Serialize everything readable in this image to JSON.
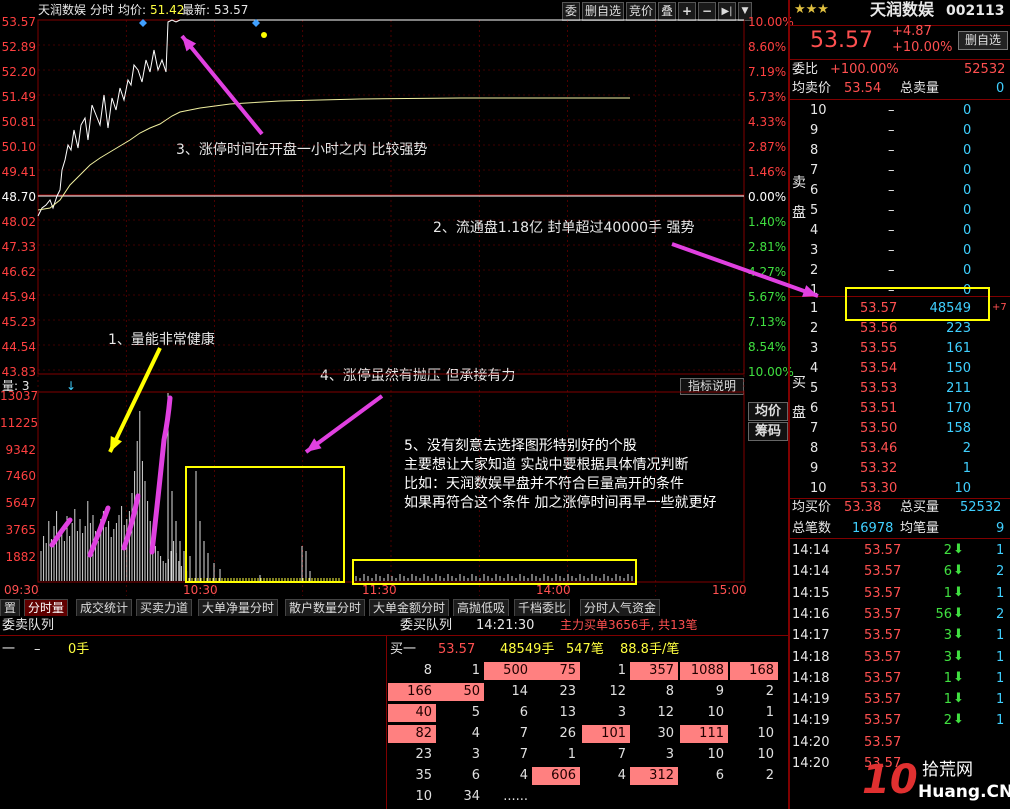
{
  "colors": {
    "up": "#ff5050",
    "down": "#40e040",
    "price_line": "#ffffff",
    "avg_line": "#f0f0a0",
    "grid": "#800000",
    "annot": "#ffffff",
    "arrow": "#e040e0",
    "box": "#ffff00"
  },
  "header": {
    "stock": "天润数娱",
    "mode": "分时",
    "avg_label": "均价:",
    "avg_value": "51.42",
    "latest_label": "最新:",
    "latest_value": "53.57",
    "buttons": [
      "委",
      "删自选",
      "竞价",
      "叠"
    ],
    "icons": [
      "plus-icon",
      "minus-icon",
      "step-right-icon",
      "dropdown-icon"
    ]
  },
  "price_axis": {
    "left": [
      "53.57",
      "52.89",
      "52.20",
      "51.49",
      "50.81",
      "50.10",
      "49.41",
      "48.70",
      "48.02",
      "47.33",
      "46.62",
      "45.94",
      "45.23",
      "44.54",
      "43.83"
    ],
    "right": [
      "10.00%",
      "8.60%",
      "7.19%",
      "5.73%",
      "4.33%",
      "2.87%",
      "1.46%",
      "0.00%",
      "1.40%",
      "2.81%",
      "4.27%",
      "5.67%",
      "7.13%",
      "8.54%",
      "10.00%"
    ]
  },
  "volume": {
    "label": "量: 3",
    "indicator_btn": "指标说明",
    "side_btns": [
      "均价",
      "筹码"
    ],
    "axis": [
      "13037",
      "11225",
      "9342",
      "7460",
      "5647",
      "3765",
      "1882"
    ],
    "times": [
      "09:30",
      "10:30",
      "11:30",
      "14:00",
      "15:00"
    ]
  },
  "chart_data": {
    "type": "line",
    "x": [
      "09:30",
      "10:00",
      "10:30",
      "11:00",
      "11:30",
      "13:30",
      "14:00",
      "14:30",
      "15:00"
    ],
    "series": [],
    "ylim": [
      43.83,
      53.57
    ]
  },
  "annotations": {
    "a1": "1、量能非常健康",
    "a2": "2、流通盘1.18亿 封单超过40000手 强势",
    "a3": "3、涨停时间在开盘一小时之内 比较强势",
    "a4": "4、涨停虽然有抛压 但承接有力",
    "a5": [
      "5、没有刻意去选择图形特别好的个股",
      "主要想让大家知道 实战中要根据具体情况判断",
      "比如：天润数娱早盘并不符合巨量高开的条件",
      "如果再符合这个条件 加之涨停时间再早一些就更好"
    ]
  },
  "tabs": [
    "置",
    "分时量",
    "成交统计",
    "买卖力道",
    "大单净量分时",
    "散户数量分时",
    "大单金额分时",
    "高抛低吸",
    "千档委比",
    "分时人气资金"
  ],
  "queue": {
    "sell_title": "委卖队列",
    "buy_title": "委买队列",
    "time": "14:21:30",
    "main_buy": "主力买单3656手, 共13笔",
    "sell_row": {
      "label": "一",
      "dash": "–",
      "qty": "0手"
    },
    "buy_head": {
      "label": "买一",
      "price": "53.57",
      "qty": "48549手",
      "count": "547笔",
      "avg": "88.8手/笔"
    },
    "grid": [
      [
        [
          "8",
          0
        ],
        [
          "1",
          0
        ],
        [
          "500",
          1
        ],
        [
          "75",
          1
        ],
        [
          "1",
          0
        ],
        [
          "357",
          1
        ],
        [
          "1088",
          1
        ],
        [
          "168",
          1
        ]
      ],
      [
        [
          "166",
          1
        ],
        [
          "50",
          1
        ],
        [
          "14",
          0
        ],
        [
          "23",
          0
        ],
        [
          "12",
          0
        ],
        [
          "8",
          0
        ],
        [
          "9",
          0
        ],
        [
          "2",
          0
        ]
      ],
      [
        [
          "40",
          1
        ],
        [
          "5",
          0
        ],
        [
          "6",
          0
        ],
        [
          "13",
          0
        ],
        [
          "3",
          0
        ],
        [
          "12",
          0
        ],
        [
          "10",
          0
        ],
        [
          "1",
          0
        ]
      ],
      [
        [
          "82",
          1
        ],
        [
          "4",
          0
        ],
        [
          "7",
          0
        ],
        [
          "26",
          0
        ],
        [
          "101",
          1
        ],
        [
          "30",
          0
        ],
        [
          "111",
          1
        ],
        [
          "10",
          0
        ]
      ],
      [
        [
          "23",
          0
        ],
        [
          "3",
          0
        ],
        [
          "7",
          0
        ],
        [
          "1",
          0
        ],
        [
          "7",
          0
        ],
        [
          "3",
          0
        ],
        [
          "10",
          0
        ],
        [
          "10",
          0
        ]
      ],
      [
        [
          "35",
          0
        ],
        [
          "6",
          0
        ],
        [
          "4",
          0
        ],
        [
          "606",
          1
        ],
        [
          "4",
          0
        ],
        [
          "312",
          1
        ],
        [
          "6",
          0
        ],
        [
          "2",
          0
        ]
      ],
      [
        [
          "10",
          0
        ],
        [
          "34",
          0
        ],
        [
          "......",
          0
        ]
      ]
    ]
  },
  "quote": {
    "stars": "★★★",
    "name": "天润数娱",
    "code": "002113",
    "price": "53.57",
    "change": "+4.87",
    "pct": "+10.00%",
    "del_btn": "删自选",
    "weibi_label": "委比",
    "weibi": "+100.00%",
    "weicha": "52532",
    "avg_sell_label": "均卖价",
    "avg_sell": "53.54",
    "total_sell_label": "总卖量",
    "total_sell": "0",
    "sell_side_label": [
      "卖",
      "盘"
    ],
    "buy_side_label": [
      "买",
      "盘"
    ],
    "sells": [
      [
        "10",
        "–",
        "0"
      ],
      [
        "9",
        "–",
        "0"
      ],
      [
        "8",
        "–",
        "0"
      ],
      [
        "7",
        "–",
        "0"
      ],
      [
        "6",
        "–",
        "0"
      ],
      [
        "5",
        "–",
        "0"
      ],
      [
        "4",
        "–",
        "0"
      ],
      [
        "3",
        "–",
        "0"
      ],
      [
        "2",
        "–",
        "0"
      ],
      [
        "1",
        "–",
        "0"
      ]
    ],
    "buys": [
      [
        "1",
        "53.57",
        "48549",
        "+7"
      ],
      [
        "2",
        "53.56",
        "223",
        ""
      ],
      [
        "3",
        "53.55",
        "161",
        ""
      ],
      [
        "4",
        "53.54",
        "150",
        ""
      ],
      [
        "5",
        "53.53",
        "211",
        ""
      ],
      [
        "6",
        "53.51",
        "170",
        ""
      ],
      [
        "7",
        "53.50",
        "158",
        ""
      ],
      [
        "8",
        "53.46",
        "2",
        ""
      ],
      [
        "9",
        "53.32",
        "1",
        ""
      ],
      [
        "10",
        "53.30",
        "10",
        ""
      ]
    ],
    "avg_buy_label": "均买价",
    "avg_buy": "53.38",
    "total_buy_label": "总买量",
    "total_buy": "52532",
    "total_trades_label": "总笔数",
    "total_trades": "16978",
    "avg_vol_label": "均笔量",
    "avg_vol": "9"
  },
  "ticks": [
    [
      "14:14",
      "53.57",
      "2",
      "1"
    ],
    [
      "14:14",
      "53.57",
      "6",
      "2"
    ],
    [
      "14:15",
      "53.57",
      "1",
      "1"
    ],
    [
      "14:16",
      "53.57",
      "56",
      "2"
    ],
    [
      "14:17",
      "53.57",
      "3",
      "1"
    ],
    [
      "14:18",
      "53.57",
      "3",
      "1"
    ],
    [
      "14:18",
      "53.57",
      "1",
      "1"
    ],
    [
      "14:19",
      "53.57",
      "1",
      "1"
    ],
    [
      "14:19",
      "53.57",
      "2",
      "1"
    ],
    [
      "14:20",
      "53.57",
      "",
      ""
    ],
    [
      "14:20",
      "53.57",
      "",
      ""
    ]
  ],
  "watermark": {
    "num": "10",
    "site": "拾荒网",
    "domain": "Huang.CN"
  }
}
